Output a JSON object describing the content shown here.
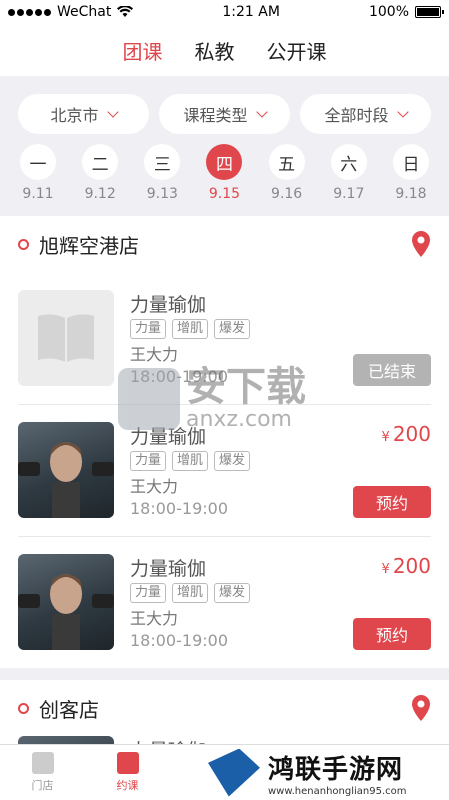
{
  "status": {
    "carrier": "WeChat",
    "time": "1:21 AM",
    "battery": "100%",
    "battery_level": 1.0
  },
  "top_tabs": [
    {
      "label": "团课",
      "active": true
    },
    {
      "label": "私教",
      "active": false
    },
    {
      "label": "公开课",
      "active": false
    }
  ],
  "filters": [
    {
      "label": "北京市"
    },
    {
      "label": "课程类型"
    },
    {
      "label": "全部时段"
    }
  ],
  "days": [
    {
      "weekday": "一",
      "date": "9.11",
      "active": false
    },
    {
      "weekday": "二",
      "date": "9.12",
      "active": false
    },
    {
      "weekday": "三",
      "date": "9.13",
      "active": false
    },
    {
      "weekday": "四",
      "date": "9.15",
      "active": true
    },
    {
      "weekday": "五",
      "date": "9.16",
      "active": false
    },
    {
      "weekday": "六",
      "date": "9.17",
      "active": false
    },
    {
      "weekday": "日",
      "date": "9.18",
      "active": false
    }
  ],
  "stores": [
    {
      "name": "旭辉空港店",
      "courses": [
        {
          "name": "力量瑜伽",
          "tags": [
            "力量",
            "增肌",
            "爆发"
          ],
          "teacher": "王大力",
          "time": "18:00-19:00",
          "price": "",
          "button": "已结束",
          "state": "ended",
          "image": "book-placeholder"
        },
        {
          "name": "力量瑜伽",
          "tags": [
            "力量",
            "增肌",
            "爆发"
          ],
          "teacher": "王大力",
          "time": "18:00-19:00",
          "price": "200",
          "currency": "¥",
          "button": "预约",
          "state": "book",
          "image": "photo"
        },
        {
          "name": "力量瑜伽",
          "tags": [
            "力量",
            "增肌",
            "爆发"
          ],
          "teacher": "王大力",
          "time": "18:00-19:00",
          "price": "200",
          "currency": "¥",
          "button": "预约",
          "state": "book",
          "image": "photo"
        }
      ]
    },
    {
      "name": "创客店",
      "courses": [
        {
          "name": "力量瑜伽",
          "image": "photo"
        }
      ]
    }
  ],
  "bottom_nav": [
    {
      "label": "门店",
      "active": false,
      "icon": "store-icon"
    },
    {
      "label": "约课",
      "active": true,
      "icon": "book-icon"
    }
  ],
  "watermarks": {
    "overlay_big": "安下载",
    "overlay_small": "anxz.com",
    "banner_big": "鸿联手游网",
    "banner_small": "www.henanhonglian95.com"
  },
  "colors": {
    "accent": "#e0474c",
    "ended": "#b3b3b3",
    "background": "#efeff4"
  }
}
